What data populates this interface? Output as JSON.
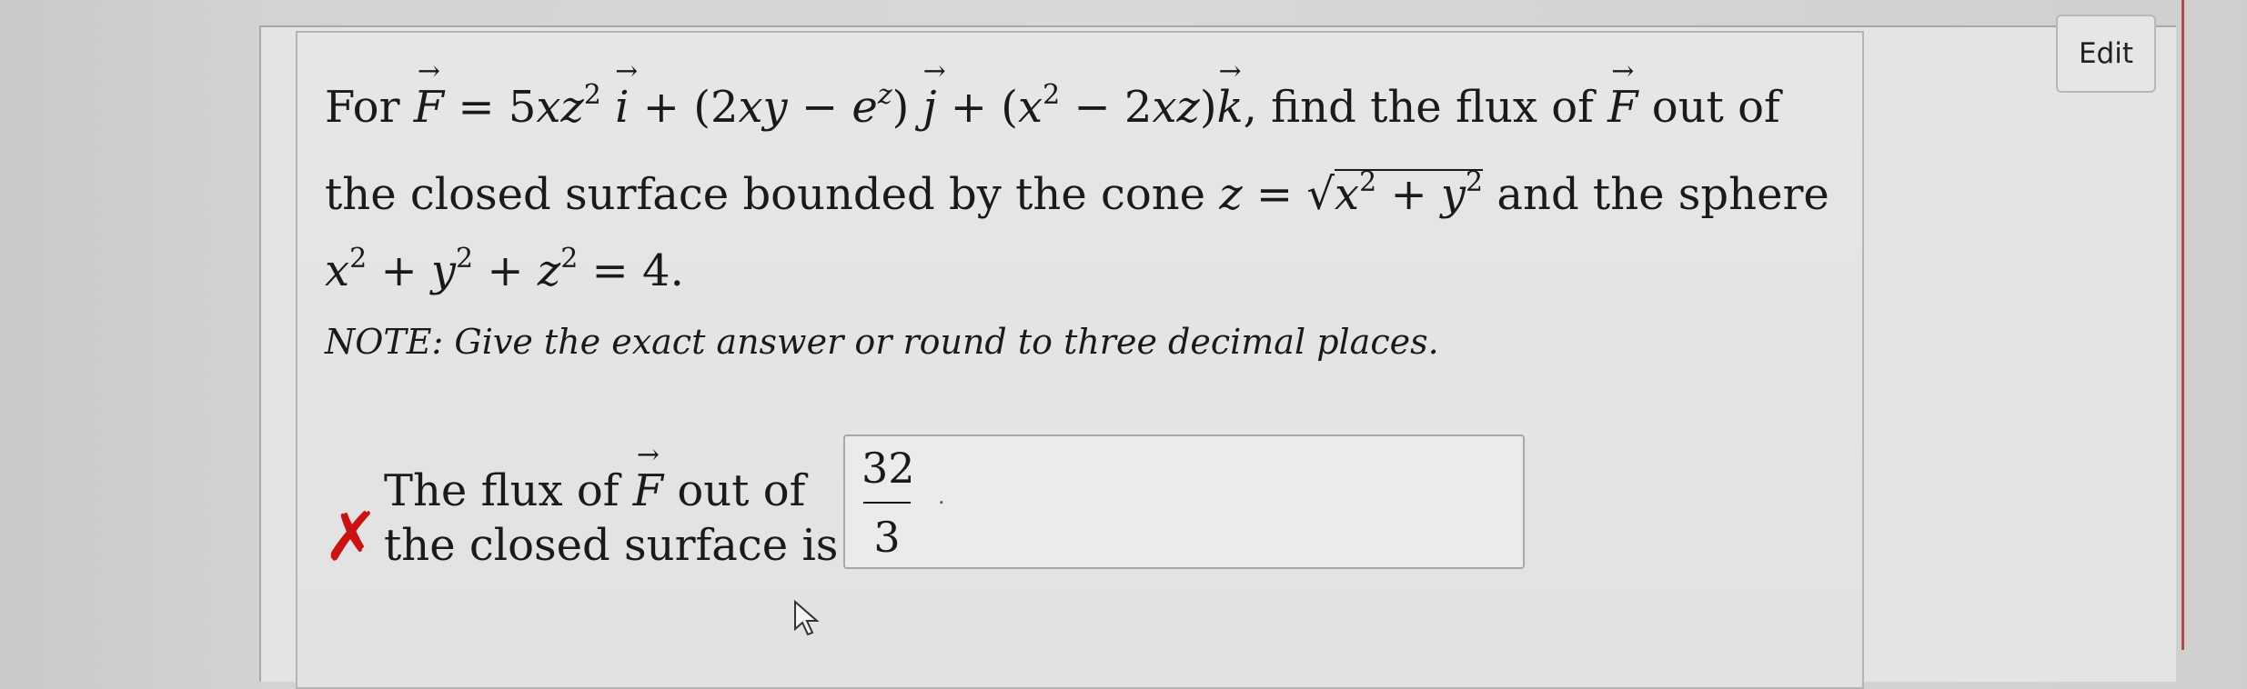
{
  "edit_button": {
    "label": "Edit"
  },
  "question": {
    "line1": {
      "prefix": "For",
      "F": "F",
      "eq_part1": "= 5",
      "xz": "xz",
      "sq1": "2",
      "i": "i",
      "plus1": "+ (2",
      "xy": "xy",
      "minus1": "−",
      "e": "e",
      "ez": "z",
      "close1": ")",
      "j": "j",
      "plus2": "+ (",
      "x": "x",
      "sq2": "2",
      "minus2": "− 2",
      "xz2": "xz",
      "close2": ")",
      "k": "k",
      "suffix": ", find the flux of",
      "F2": "F",
      "suffix2": "out of"
    },
    "line2": {
      "prefix": "the closed surface bounded by the cone",
      "z": "z",
      "eq": "=",
      "root_x": "x",
      "root_sq1": "2",
      "root_plus": "+",
      "root_y": "y",
      "root_sq2": "2",
      "suffix": "and the sphere"
    },
    "line3": {
      "x": "x",
      "sq1": "2",
      "p1": "+",
      "y": "y",
      "sq2": "2",
      "p2": "+",
      "z": "z",
      "sq3": "2",
      "rest": "= 4."
    },
    "note": "NOTE: Give the exact answer or round to three decimal places."
  },
  "answer": {
    "status": "incorrect",
    "wrong_mark": "✗",
    "label_line1_a": "The flux of",
    "label_F": "F",
    "label_line1_b": "out of",
    "label_line2": "the closed surface is",
    "numerator": "32",
    "denominator": "3",
    "trailing": "."
  },
  "colors": {
    "wrong_mark": "#cc1111",
    "accent_line": "#b24a4a"
  },
  "icons": {
    "cursor": "mouse-pointer-icon"
  }
}
